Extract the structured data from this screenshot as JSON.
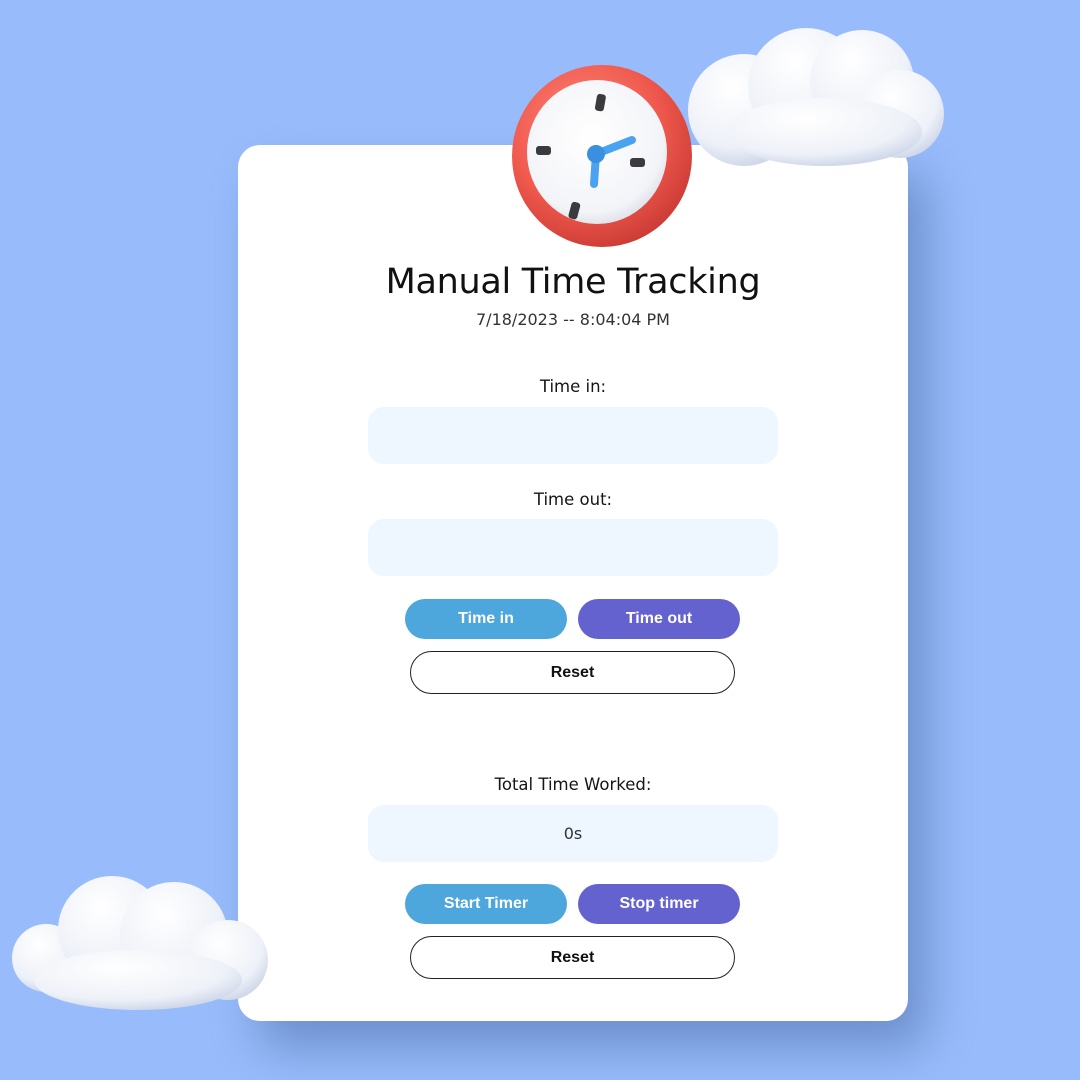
{
  "app": {
    "title": "Manual Time Tracking",
    "datetime": "7/18/2023 -- 8:04:04 PM"
  },
  "manual": {
    "time_in_label": "Time in:",
    "time_in_value": "",
    "time_out_label": "Time out:",
    "time_out_value": "",
    "time_in_button": "Time in",
    "time_out_button": "Time out",
    "reset_button": "Reset"
  },
  "timer": {
    "total_label": "Total Time Worked:",
    "total_value": "0s",
    "start_button": "Start Timer",
    "stop_button": "Stop timer",
    "reset_button": "Reset"
  },
  "icons": {
    "hero": "alarm-clock-icon",
    "decor": "cloud-icon"
  },
  "colors": {
    "background": "#98bcfb",
    "card": "#ffffff",
    "field": "#eef6ff",
    "primary_button": "#4da6dc",
    "secondary_button": "#6362ce",
    "clock_rim": "#f0594e",
    "clock_hands": "#4aa3f0"
  }
}
